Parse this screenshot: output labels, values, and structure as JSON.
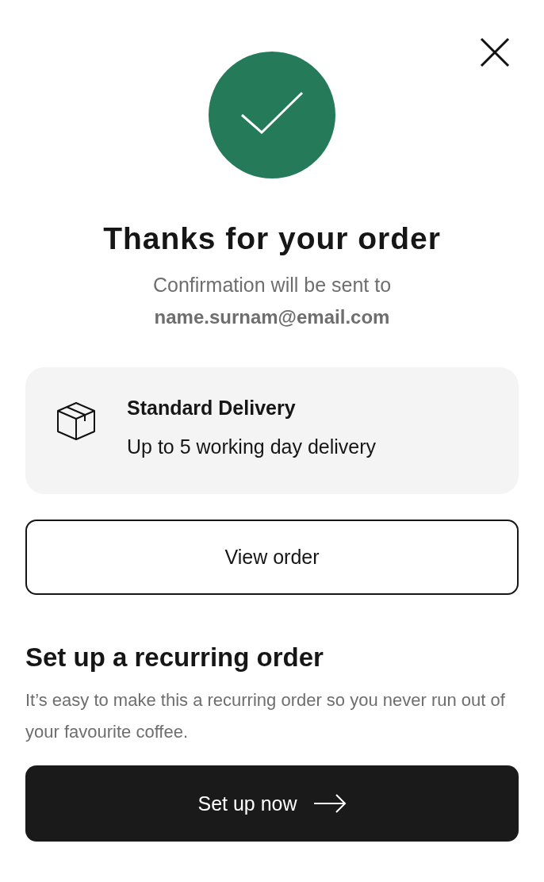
{
  "title": "Thanks for your order",
  "confirmation": {
    "text": "Confirmation will be sent to",
    "email": "name.surnam@email.com"
  },
  "delivery": {
    "title": "Standard Delivery",
    "description": "Up to 5 working day delivery"
  },
  "view_button": "View order",
  "recurring": {
    "heading": "Set up a recurring order",
    "text": "It’s easy to make this a recurring order so you never run out of your favourite coffee.",
    "button": "Set up now"
  }
}
